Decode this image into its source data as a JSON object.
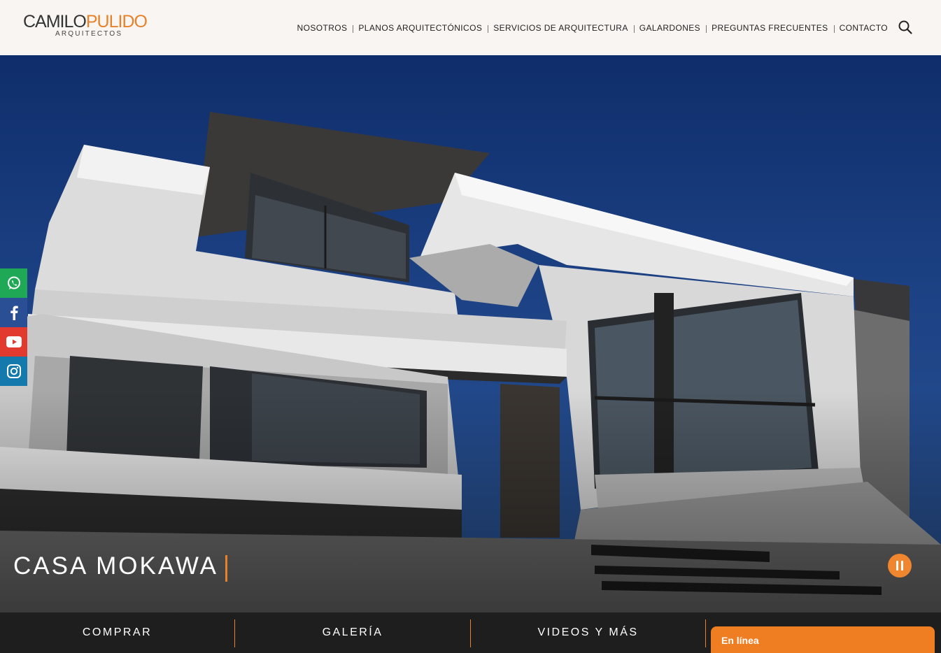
{
  "logo": {
    "part_a": "CAMILO",
    "part_b": "PULIDO",
    "subtitle": "ARQUITECTOS"
  },
  "nav": {
    "items": [
      "NOSOTROS",
      "PLANOS ARQUITECTÓNICOS",
      "SERVICIOS DE ARQUITECTURA",
      "GALARDONES",
      "PREGUNTAS FRECUENTES",
      "CONTACTO"
    ],
    "search_icon": "search-icon"
  },
  "hero": {
    "title": "CASA MOKAWA",
    "pause_icon": "pause-icon"
  },
  "social": [
    "whatsapp-icon",
    "facebook-icon",
    "youtube-icon",
    "instagram-icon"
  ],
  "bottom_tabs": [
    "COMPRAR",
    "GALERÍA",
    "VIDEOS Y MÁS"
  ],
  "chat": {
    "label": "En línea"
  },
  "colors": {
    "accent": "#e8822a",
    "header_bg": "#f9f5f3",
    "bottom_bg": "#1e1e1e",
    "whatsapp": "#1fa855",
    "facebook": "#2a4f95",
    "youtube": "#e23a2e",
    "instagram": "#1479ad"
  }
}
